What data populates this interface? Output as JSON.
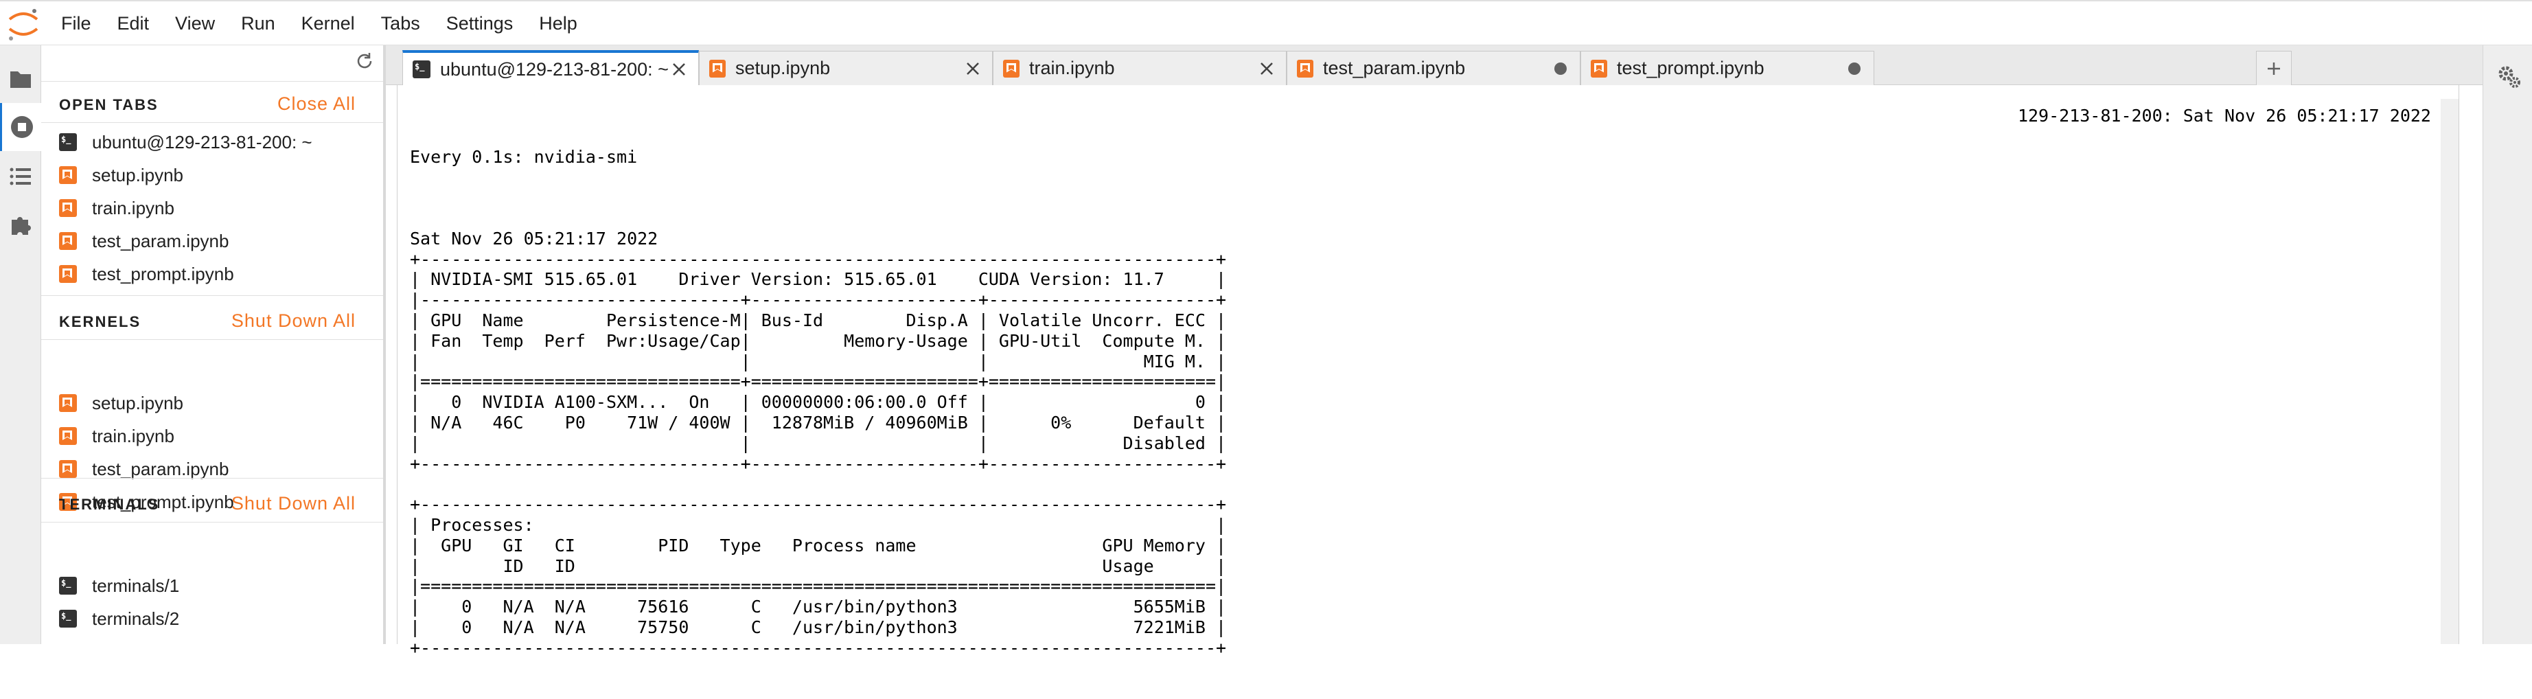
{
  "menu": {
    "items": [
      "File",
      "Edit",
      "View",
      "Run",
      "Kernel",
      "Tabs",
      "Settings",
      "Help"
    ]
  },
  "left_sidebar_icons": [
    "folder-icon",
    "running-icon",
    "toc-icon",
    "extension-icon"
  ],
  "sidebar": {
    "open_tabs": {
      "heading": "OPEN TABS",
      "action": "Close All",
      "items": [
        {
          "label": "ubuntu@129-213-81-200: ~",
          "icon": "terminal"
        },
        {
          "label": "setup.ipynb",
          "icon": "notebook"
        },
        {
          "label": "train.ipynb",
          "icon": "notebook"
        },
        {
          "label": "test_param.ipynb",
          "icon": "notebook"
        },
        {
          "label": "test_prompt.ipynb",
          "icon": "notebook"
        }
      ]
    },
    "kernels": {
      "heading": "KERNELS",
      "action": "Shut Down All",
      "items": [
        {
          "label": "setup.ipynb",
          "icon": "notebook"
        },
        {
          "label": "train.ipynb",
          "icon": "notebook"
        },
        {
          "label": "test_param.ipynb",
          "icon": "notebook"
        },
        {
          "label": "test_prompt.ipynb",
          "icon": "notebook"
        }
      ]
    },
    "terminals": {
      "heading": "TERMINALS",
      "action": "Shut Down All",
      "items": [
        {
          "label": "terminals/1",
          "icon": "terminal"
        },
        {
          "label": "terminals/2",
          "icon": "terminal"
        }
      ]
    }
  },
  "tabs": [
    {
      "label": "ubuntu@129-213-81-200: ~",
      "icon": "terminal",
      "active": true,
      "state": "close"
    },
    {
      "label": "setup.ipynb",
      "icon": "notebook",
      "active": false,
      "state": "close"
    },
    {
      "label": "train.ipynb",
      "icon": "notebook",
      "active": false,
      "state": "close"
    },
    {
      "label": "test_param.ipynb",
      "icon": "notebook",
      "active": false,
      "state": "modified"
    },
    {
      "label": "test_prompt.ipynb",
      "icon": "notebook",
      "active": false,
      "state": "modified"
    }
  ],
  "terminal": {
    "header_left": "Every 0.1s: nvidia-smi",
    "header_right": "129-213-81-200: Sat Nov 26 05:21:17 2022",
    "lines": [
      "",
      "Sat Nov 26 05:21:17 2022",
      "+-----------------------------------------------------------------------------+",
      "| NVIDIA-SMI 515.65.01    Driver Version: 515.65.01    CUDA Version: 11.7     |",
      "|-------------------------------+----------------------+----------------------+",
      "| GPU  Name        Persistence-M| Bus-Id        Disp.A | Volatile Uncorr. ECC |",
      "| Fan  Temp  Perf  Pwr:Usage/Cap|         Memory-Usage | GPU-Util  Compute M. |",
      "|                               |                      |               MIG M. |",
      "|===============================+======================+======================|",
      "|   0  NVIDIA A100-SXM...  On   | 00000000:06:00.0 Off |                    0 |",
      "| N/A   46C    P0    71W / 400W |  12878MiB / 40960MiB |      0%      Default |",
      "|                               |                      |             Disabled |",
      "+-------------------------------+----------------------+----------------------+",
      "",
      "+-----------------------------------------------------------------------------+",
      "| Processes:                                                                  |",
      "|  GPU   GI   CI        PID   Type   Process name                  GPU Memory |",
      "|        ID   ID                                                   Usage      |",
      "|=============================================================================|",
      "|    0   N/A  N/A     75616      C   /usr/bin/python3                 5655MiB |",
      "|    0   N/A  N/A     75750      C   /usr/bin/python3                 7221MiB |",
      "+-----------------------------------------------------------------------------+"
    ]
  },
  "colors": {
    "accent": "#f37726",
    "active_tab_border": "#1976d2"
  }
}
